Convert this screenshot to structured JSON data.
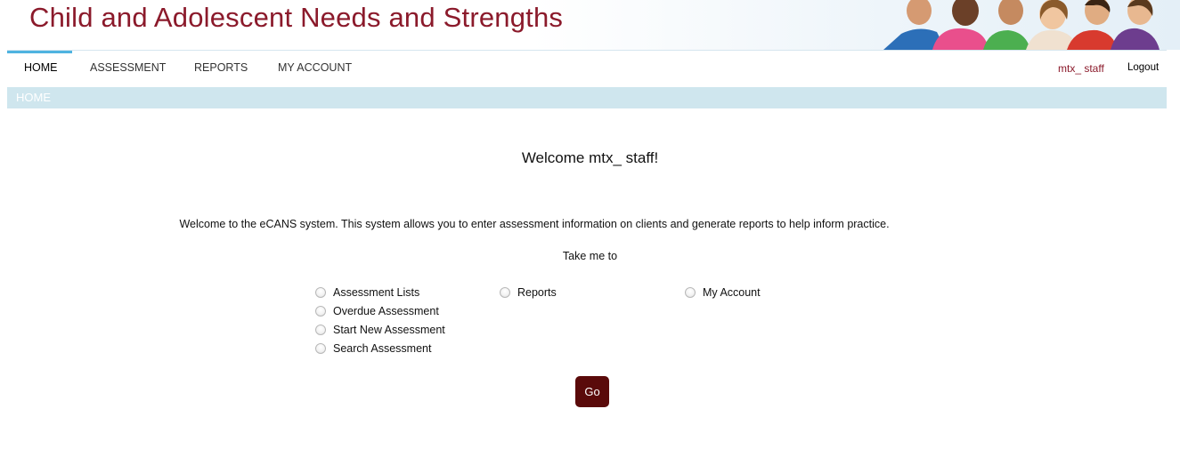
{
  "banner": {
    "title": "Child and Adolescent Needs and Strengths"
  },
  "nav": {
    "items": [
      {
        "label": "HOME"
      },
      {
        "label": "ASSESSMENT"
      },
      {
        "label": "REPORTS"
      },
      {
        "label": "MY ACCOUNT"
      }
    ],
    "active": "HOME",
    "username": "mtx_ staff",
    "logout_label": "Logout"
  },
  "breadcrumb": {
    "current": "HOME"
  },
  "main": {
    "welcome_title": "Welcome mtx_ staff!",
    "intro_text": "Welcome to the eCANS system. This system allows you to enter assessment information on clients and generate reports to help inform practice.",
    "take_me_label": "Take me to",
    "options": [
      {
        "label": "Assessment Lists"
      },
      {
        "label": "Overdue Assessment"
      },
      {
        "label": "Start New Assessment"
      },
      {
        "label": "Search Assessment"
      },
      {
        "label": "Reports"
      },
      {
        "label": "My Account"
      }
    ],
    "go_label": "Go"
  },
  "colors": {
    "title": "#8b1a2b",
    "nav_active_underline": "#4fb3e0",
    "breadcrumb_bar": "#cfe6ee",
    "go_button": "#5a0a0a"
  }
}
